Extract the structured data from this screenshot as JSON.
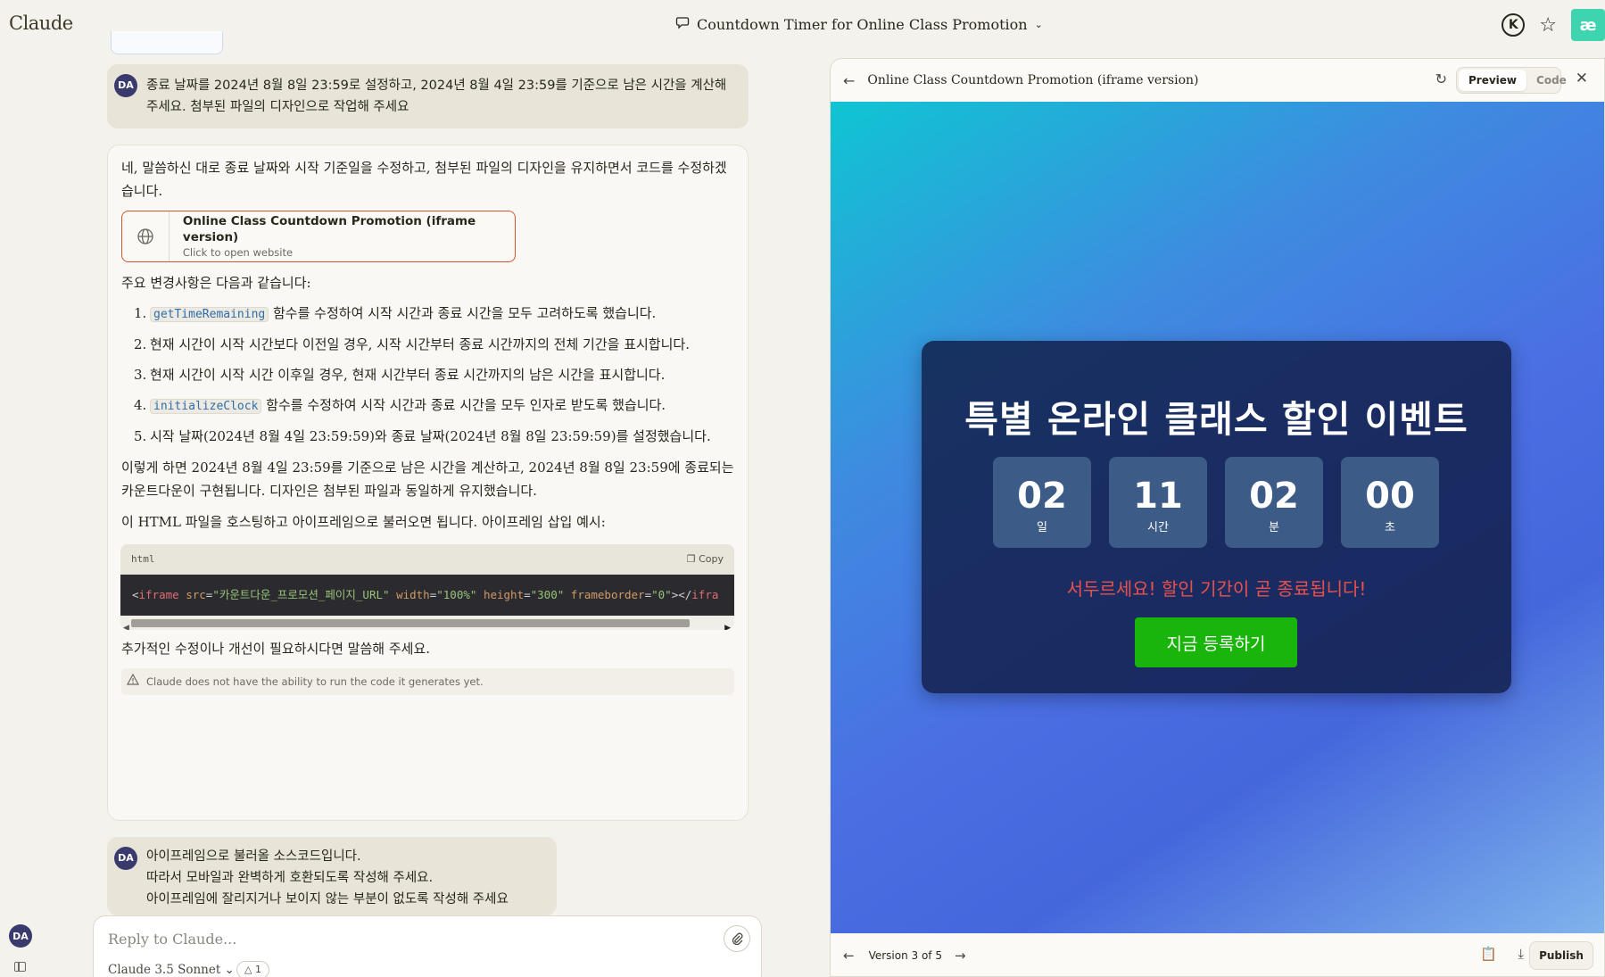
{
  "app": {
    "brand": "Claude",
    "chat_title": "Countdown Timer for Online Class Promotion"
  },
  "user": {
    "initials": "DA"
  },
  "messages": {
    "user1": "종료 날짜를 2024년 8월 8일 23:59로 설정하고, 2024년 8월 4일 23:59를 기준으로 남은 시간을 계산해 주세요. 첨부된 파일의 디자인으로 작업해 주세요",
    "assistant": {
      "intro": "네, 말씀하신 대로 종료 날짜와 시작 기준일을 수정하고, 첨부된 파일의 디자인을 유지하면서 코드를 수정하겠습니다.",
      "artifact_title": "Online Class Countdown Promotion (iframe version)",
      "artifact_sub": "Click to open website",
      "changes_heading": "주요 변경사항은 다음과 같습니다:",
      "changes": [
        {
          "num": "1.",
          "code": "getTimeRemaining",
          "text": " 함수를 수정하여 시작 시간과 종료 시간을 모두 고려하도록 했습니다."
        },
        {
          "num": "2.",
          "code": "",
          "text": "현재 시간이 시작 시간보다 이전일 경우, 시작 시간부터 종료 시간까지의 전체 기간을 표시합니다."
        },
        {
          "num": "3.",
          "code": "",
          "text": "현재 시간이 시작 시간 이후일 경우, 현재 시간부터 종료 시간까지의 남은 시간을 표시합니다."
        },
        {
          "num": "4.",
          "code": "initializeClock",
          "text": " 함수를 수정하여 시작 시간과 종료 시간을 모두 인자로 받도록 했습니다."
        },
        {
          "num": "5.",
          "code": "",
          "text": "시작 날짜(2024년 8월 4일 23:59:59)와 종료 날짜(2024년 8월 8일 23:59:59)를 설정했습니다."
        }
      ],
      "summary": "이렇게 하면 2024년 8월 4일 23:59를 기준으로 남은 시간을 계산하고, 2024년 8월 8일 23:59에 종료되는 카운트다운이 구현됩니다. 디자인은 첨부된 파일과 동일하게 유지했습니다.",
      "iframe_note": "이 HTML 파일을 호스팅하고 아이프레임으로 불러오면 됩니다. 아이프레임 삽입 예시:",
      "code_lang": "html",
      "copy_label": "Copy",
      "code": {
        "open": "<",
        "tag": "iframe",
        "a1": "src",
        "v1": "\"카운트다운_프로모션_페이지_URL\"",
        "a2": "width",
        "v2": "\"100%\"",
        "a3": "height",
        "v3": "\"300\"",
        "a4": "frameborder",
        "v4": "\"0\"",
        "close": "></",
        "tag2": "ifra"
      },
      "closing": "추가적인 수정이나 개선이 필요하시다면 말씀해 주세요.",
      "disclaimer": "Claude does not have the ability to run the code it generates yet."
    },
    "user2": [
      "아이프레임으로 불러올 소스코드입니다.",
      "따라서 모바일과 완벽하게 호환되도록 작성해 주세요.",
      "아이프레임에 잘리지거나 보이지 않는 부분이 없도록 작성해 주세요"
    ]
  },
  "reply": {
    "placeholder": "Reply to Claude...",
    "model": "Claude 3.5 Sonnet",
    "badge": "1"
  },
  "artifact": {
    "title": "Online Class Countdown Promotion (iframe version)",
    "tab_preview": "Preview",
    "tab_code": "Code",
    "version": "Version 3 of 5",
    "publish": "Publish",
    "preview": {
      "headline": "특별 온라인 클래스 할인 이벤트",
      "units": [
        {
          "value": "02",
          "label": "일"
        },
        {
          "value": "11",
          "label": "시간"
        },
        {
          "value": "02",
          "label": "분"
        },
        {
          "value": "00",
          "label": "초"
        }
      ],
      "urgent": "서두르세요! 할인 기간이 곧 종료됩니다!",
      "cta": "지금 등록하기"
    }
  },
  "icons": [
    "chat-bubble-icon",
    "chevron-down-icon",
    "k-account-icon",
    "star-icon",
    "extension-icon",
    "globe-icon",
    "copy-icon",
    "warning-icon",
    "paperclip-icon",
    "back-arrow-icon",
    "refresh-icon",
    "close-icon",
    "prev-icon",
    "next-icon",
    "clipboard-icon",
    "download-icon",
    "sidebar-toggle-icon"
  ],
  "colors": {
    "accent_orange": "#d2552f",
    "cta_green": "#19b50a",
    "urgent_red": "#e8514d",
    "card_navy": "#101c46",
    "box_blue": "#3c5b87"
  }
}
